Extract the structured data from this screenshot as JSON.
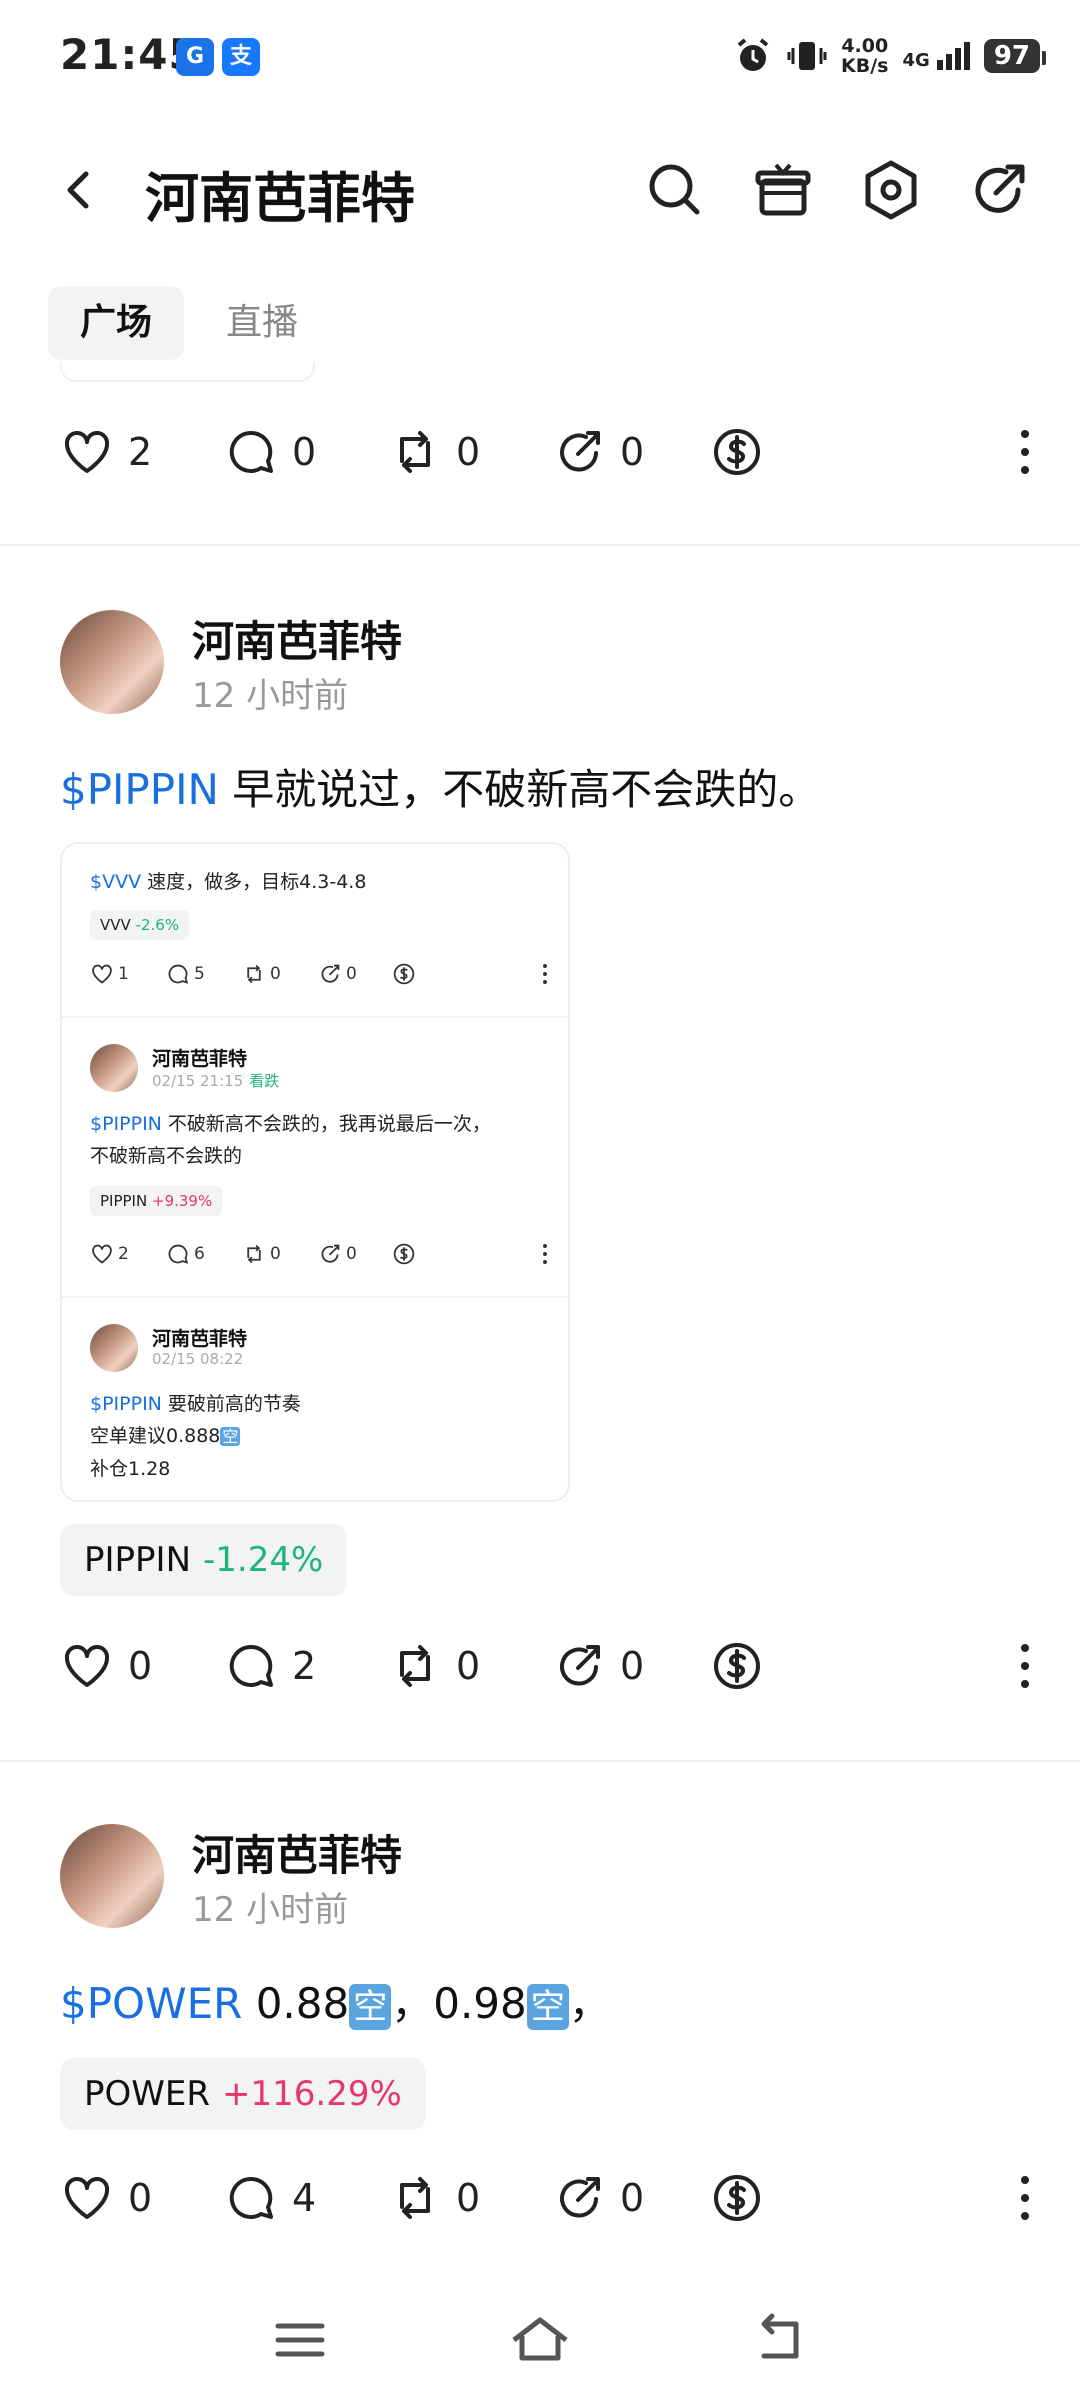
{
  "status_bar": {
    "time": "21:45",
    "app_icons": [
      "G",
      "支"
    ],
    "speed_value": "4.00",
    "speed_unit": "KB/s",
    "network": "4G",
    "battery": "97"
  },
  "header": {
    "title": "河南芭菲特",
    "icons": [
      "back-icon",
      "search-icon",
      "gift-icon",
      "settings-icon",
      "share-icon"
    ]
  },
  "tabs": [
    {
      "label": "广场",
      "active": true
    },
    {
      "label": "直播",
      "active": false
    }
  ],
  "top_actions": {
    "likes": "2",
    "comments": "0",
    "reposts": "0",
    "shares": "0"
  },
  "posts": [
    {
      "author": "河南芭菲特",
      "time": "12 小时前",
      "cashtag": "$PIPPIN",
      "text": " 早就说过，不破新高不会跌的。",
      "embed": {
        "items": [
          {
            "cashtag": "$VVV",
            "text": " 速度，做多，目标4.3-4.8",
            "chip_symbol": "VVV",
            "chip_change": "-2.6%",
            "likes": "1",
            "comments": "5",
            "reposts": "0",
            "shares": "0"
          },
          {
            "author": "河南芭菲特",
            "time": "02/15 21:15",
            "sentiment": "看跌",
            "cashtag": "$PIPPIN",
            "text_line1": " 不破新高不会跌的，我再说最后一次，",
            "text_line2": "不破新高不会跌的",
            "chip_symbol": "PIPPIN",
            "chip_change": "+9.39%",
            "likes": "2",
            "comments": "6",
            "reposts": "0",
            "shares": "0"
          },
          {
            "author": "河南芭菲特",
            "time": "02/15 08:22",
            "cashtag": "$PIPPIN",
            "text_line1": " 要破前高的节奏",
            "text_line2": "空单建议0.888",
            "kong": "空",
            "text_line3": "补仓1.28"
          }
        ]
      },
      "chip_symbol": "PIPPIN",
      "chip_change": "-1.24%",
      "likes": "0",
      "comments": "2",
      "reposts": "0",
      "shares": "0"
    },
    {
      "author": "河南芭菲特",
      "time": "12 小时前",
      "cashtag": "$POWER",
      "text_part1": " 0.88",
      "kong": "空",
      "text_part2": "，0.98",
      "text_part3": "，",
      "chip_symbol": "POWER",
      "chip_change": "+116.29%",
      "likes": "0",
      "comments": "4",
      "reposts": "0",
      "shares": "0"
    }
  ],
  "colors": {
    "cashtag": "#1a6fe0",
    "down": "#1fb47a",
    "up": "#e8356a"
  },
  "navbar": {
    "icons": [
      "menu-icon",
      "home-icon",
      "back-nav-icon"
    ]
  }
}
